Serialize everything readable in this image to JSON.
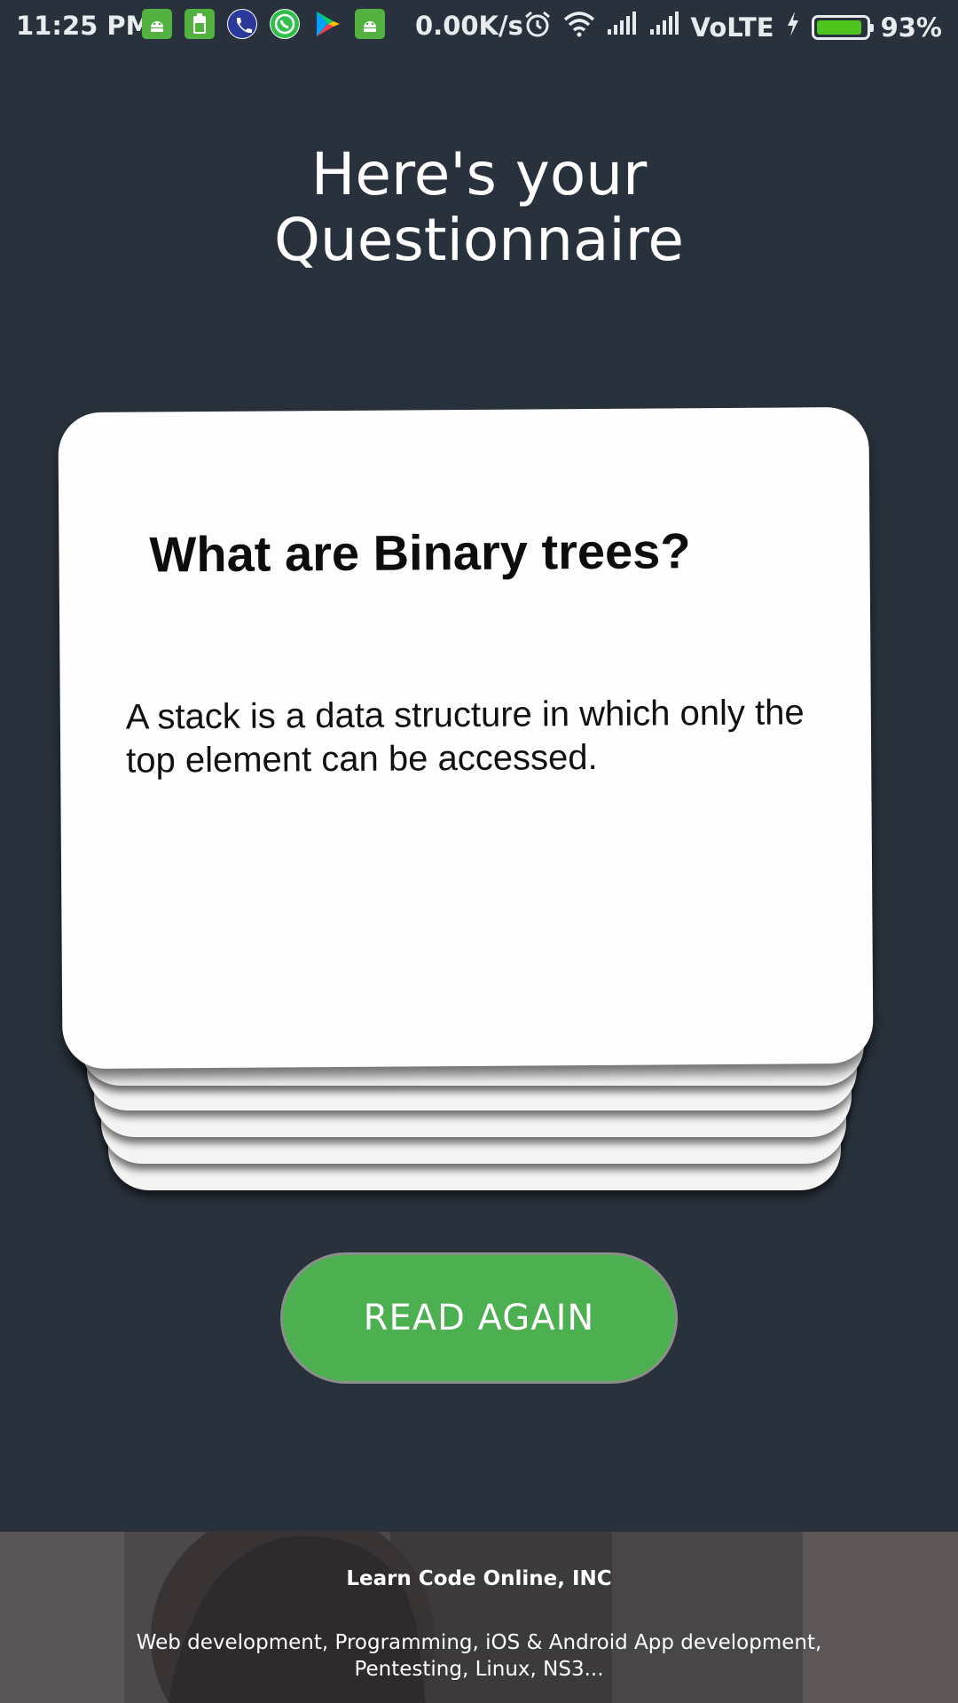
{
  "status_bar": {
    "time": "11:25 PM",
    "net_speed": "0.00K/s",
    "network_label": "VoLTE",
    "battery_percent_label": "93%",
    "battery_level": 0.93,
    "notification_icons": [
      "android-icon",
      "battery-app-icon",
      "phone-app-icon",
      "whatsapp-icon",
      "play-store-icon",
      "android-icon"
    ],
    "status_icons": [
      "alarm-icon",
      "wifi-icon",
      "signal-icon",
      "signal-icon",
      "charging-icon"
    ],
    "colors": {
      "notif_green": "#53b23f",
      "battery_fill": "#4ec41f"
    }
  },
  "page": {
    "heading_line1": "Here's your",
    "heading_line2": "Questionnaire",
    "background": "#29323c"
  },
  "card": {
    "question": "What are Binary trees?",
    "answer": "A stack is a data structure in which only the top element can be accessed."
  },
  "actions": {
    "read_again_label": "READ AGAIN",
    "button_color": "#4caf50"
  },
  "footer": {
    "company": "Learn Code Online, INC",
    "description": "Web development, Programming, iOS & Android App development, Pentesting, Linux, NS3..."
  }
}
